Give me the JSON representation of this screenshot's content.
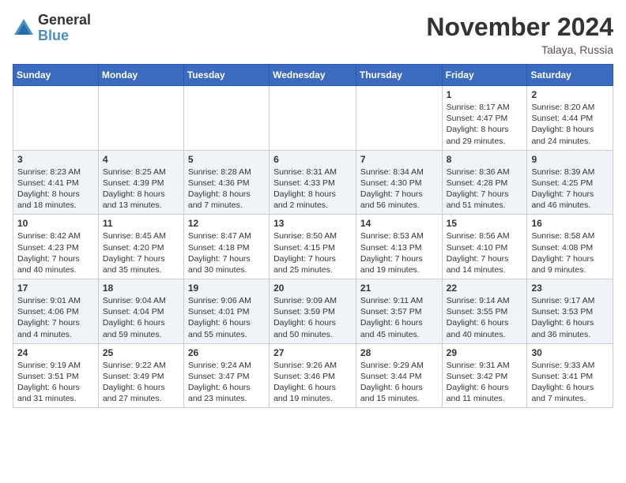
{
  "header": {
    "logo_general": "General",
    "logo_blue": "Blue",
    "month_title": "November 2024",
    "location": "Talaya, Russia"
  },
  "calendar": {
    "weekdays": [
      "Sunday",
      "Monday",
      "Tuesday",
      "Wednesday",
      "Thursday",
      "Friday",
      "Saturday"
    ],
    "rows": [
      [
        {
          "day": "",
          "info": ""
        },
        {
          "day": "",
          "info": ""
        },
        {
          "day": "",
          "info": ""
        },
        {
          "day": "",
          "info": ""
        },
        {
          "day": "",
          "info": ""
        },
        {
          "day": "1",
          "info": "Sunrise: 8:17 AM\nSunset: 4:47 PM\nDaylight: 8 hours\nand 29 minutes."
        },
        {
          "day": "2",
          "info": "Sunrise: 8:20 AM\nSunset: 4:44 PM\nDaylight: 8 hours\nand 24 minutes."
        }
      ],
      [
        {
          "day": "3",
          "info": "Sunrise: 8:23 AM\nSunset: 4:41 PM\nDaylight: 8 hours\nand 18 minutes."
        },
        {
          "day": "4",
          "info": "Sunrise: 8:25 AM\nSunset: 4:39 PM\nDaylight: 8 hours\nand 13 minutes."
        },
        {
          "day": "5",
          "info": "Sunrise: 8:28 AM\nSunset: 4:36 PM\nDaylight: 8 hours\nand 7 minutes."
        },
        {
          "day": "6",
          "info": "Sunrise: 8:31 AM\nSunset: 4:33 PM\nDaylight: 8 hours\nand 2 minutes."
        },
        {
          "day": "7",
          "info": "Sunrise: 8:34 AM\nSunset: 4:30 PM\nDaylight: 7 hours\nand 56 minutes."
        },
        {
          "day": "8",
          "info": "Sunrise: 8:36 AM\nSunset: 4:28 PM\nDaylight: 7 hours\nand 51 minutes."
        },
        {
          "day": "9",
          "info": "Sunrise: 8:39 AM\nSunset: 4:25 PM\nDaylight: 7 hours\nand 46 minutes."
        }
      ],
      [
        {
          "day": "10",
          "info": "Sunrise: 8:42 AM\nSunset: 4:23 PM\nDaylight: 7 hours\nand 40 minutes."
        },
        {
          "day": "11",
          "info": "Sunrise: 8:45 AM\nSunset: 4:20 PM\nDaylight: 7 hours\nand 35 minutes."
        },
        {
          "day": "12",
          "info": "Sunrise: 8:47 AM\nSunset: 4:18 PM\nDaylight: 7 hours\nand 30 minutes."
        },
        {
          "day": "13",
          "info": "Sunrise: 8:50 AM\nSunset: 4:15 PM\nDaylight: 7 hours\nand 25 minutes."
        },
        {
          "day": "14",
          "info": "Sunrise: 8:53 AM\nSunset: 4:13 PM\nDaylight: 7 hours\nand 19 minutes."
        },
        {
          "day": "15",
          "info": "Sunrise: 8:56 AM\nSunset: 4:10 PM\nDaylight: 7 hours\nand 14 minutes."
        },
        {
          "day": "16",
          "info": "Sunrise: 8:58 AM\nSunset: 4:08 PM\nDaylight: 7 hours\nand 9 minutes."
        }
      ],
      [
        {
          "day": "17",
          "info": "Sunrise: 9:01 AM\nSunset: 4:06 PM\nDaylight: 7 hours\nand 4 minutes."
        },
        {
          "day": "18",
          "info": "Sunrise: 9:04 AM\nSunset: 4:04 PM\nDaylight: 6 hours\nand 59 minutes."
        },
        {
          "day": "19",
          "info": "Sunrise: 9:06 AM\nSunset: 4:01 PM\nDaylight: 6 hours\nand 55 minutes."
        },
        {
          "day": "20",
          "info": "Sunrise: 9:09 AM\nSunset: 3:59 PM\nDaylight: 6 hours\nand 50 minutes."
        },
        {
          "day": "21",
          "info": "Sunrise: 9:11 AM\nSunset: 3:57 PM\nDaylight: 6 hours\nand 45 minutes."
        },
        {
          "day": "22",
          "info": "Sunrise: 9:14 AM\nSunset: 3:55 PM\nDaylight: 6 hours\nand 40 minutes."
        },
        {
          "day": "23",
          "info": "Sunrise: 9:17 AM\nSunset: 3:53 PM\nDaylight: 6 hours\nand 36 minutes."
        }
      ],
      [
        {
          "day": "24",
          "info": "Sunrise: 9:19 AM\nSunset: 3:51 PM\nDaylight: 6 hours\nand 31 minutes."
        },
        {
          "day": "25",
          "info": "Sunrise: 9:22 AM\nSunset: 3:49 PM\nDaylight: 6 hours\nand 27 minutes."
        },
        {
          "day": "26",
          "info": "Sunrise: 9:24 AM\nSunset: 3:47 PM\nDaylight: 6 hours\nand 23 minutes."
        },
        {
          "day": "27",
          "info": "Sunrise: 9:26 AM\nSunset: 3:46 PM\nDaylight: 6 hours\nand 19 minutes."
        },
        {
          "day": "28",
          "info": "Sunrise: 9:29 AM\nSunset: 3:44 PM\nDaylight: 6 hours\nand 15 minutes."
        },
        {
          "day": "29",
          "info": "Sunrise: 9:31 AM\nSunset: 3:42 PM\nDaylight: 6 hours\nand 11 minutes."
        },
        {
          "day": "30",
          "info": "Sunrise: 9:33 AM\nSunset: 3:41 PM\nDaylight: 6 hours\nand 7 minutes."
        }
      ]
    ]
  }
}
